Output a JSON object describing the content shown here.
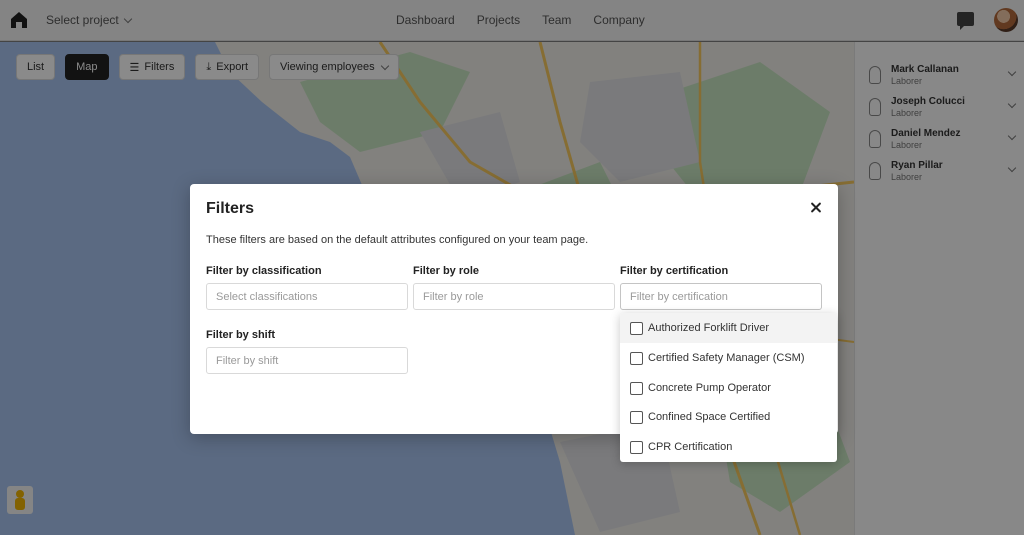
{
  "topbar": {
    "project_select": "Select project",
    "nav": [
      "Dashboard",
      "Projects",
      "Team",
      "Company"
    ]
  },
  "map_controls": {
    "list_label": "List",
    "map_label": "Map",
    "filters_label": "Filters",
    "export_label": "Export",
    "view_select": "Viewing employees"
  },
  "employees": [
    {
      "name": "Mark Callanan",
      "role": "Laborer"
    },
    {
      "name": "Joseph Colucci",
      "role": "Laborer"
    },
    {
      "name": "Daniel Mendez",
      "role": "Laborer"
    },
    {
      "name": "Ryan Pillar",
      "role": "Laborer"
    }
  ],
  "modal": {
    "title": "Filters",
    "description": "These filters are based on the default attributes configured on your team page.",
    "classification": {
      "label": "Filter by classification",
      "placeholder": "Select classifications"
    },
    "role": {
      "label": "Filter by role",
      "placeholder": "Filter by role"
    },
    "certification": {
      "label": "Filter by certification",
      "placeholder": "Filter by certification"
    },
    "shift": {
      "label": "Filter by shift",
      "placeholder": "Filter by shift"
    }
  },
  "certification_options": [
    "Authorized Forklift Driver",
    "Certified Safety Manager (CSM)",
    "Concrete Pump Operator",
    "Confined Space Certified",
    "CPR Certification"
  ],
  "colors": {
    "ocean": "#a9c4f0",
    "land": "#f0efe9",
    "park": "#c8e6c2",
    "urban": "#e2e2e6",
    "highway": "#f7c95e",
    "overlay": "rgba(0,0,0,0.46)"
  }
}
